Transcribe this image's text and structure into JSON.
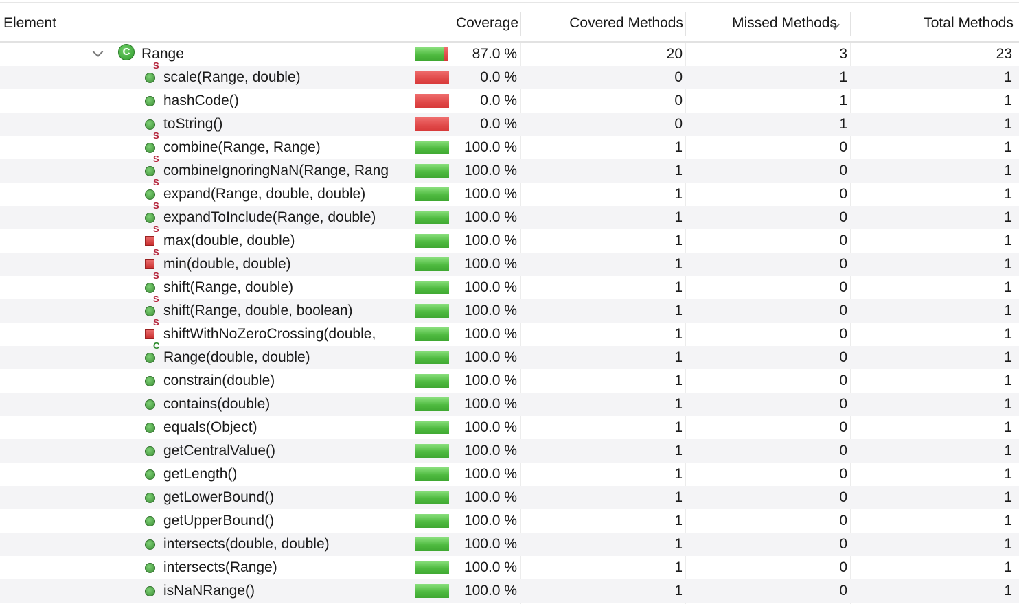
{
  "headers": {
    "element": "Element",
    "coverage": "Coverage",
    "covered": "Covered Methods",
    "missed": "Missed Methods",
    "total": "Total Methods",
    "sort_icon": "chevron-down-icon"
  },
  "top": {
    "name": "Range",
    "icon": "class-icon",
    "icon_letter": "C",
    "expanded": true,
    "pct": "87.0 %",
    "ratio": 0.87,
    "covered": "20",
    "missed": "3",
    "total": "23"
  },
  "rows": [
    {
      "name": "scale(Range, double)",
      "icon": "public",
      "mod": "S",
      "pct": "0.0 %",
      "ratio": 0,
      "covered": "0",
      "missed": "1",
      "total": "1"
    },
    {
      "name": "hashCode()",
      "icon": "public",
      "mod": "",
      "pct": "0.0 %",
      "ratio": 0,
      "covered": "0",
      "missed": "1",
      "total": "1"
    },
    {
      "name": "toString()",
      "icon": "public",
      "mod": "",
      "pct": "0.0 %",
      "ratio": 0,
      "covered": "0",
      "missed": "1",
      "total": "1"
    },
    {
      "name": "combine(Range, Range)",
      "icon": "public",
      "mod": "S",
      "pct": "100.0 %",
      "ratio": 1,
      "covered": "1",
      "missed": "0",
      "total": "1"
    },
    {
      "name": "combineIgnoringNaN(Range, Rang",
      "icon": "public",
      "mod": "S",
      "pct": "100.0 %",
      "ratio": 1,
      "covered": "1",
      "missed": "0",
      "total": "1"
    },
    {
      "name": "expand(Range, double, double)",
      "icon": "public",
      "mod": "S",
      "pct": "100.0 %",
      "ratio": 1,
      "covered": "1",
      "missed": "0",
      "total": "1"
    },
    {
      "name": "expandToInclude(Range, double)",
      "icon": "public",
      "mod": "S",
      "pct": "100.0 %",
      "ratio": 1,
      "covered": "1",
      "missed": "0",
      "total": "1"
    },
    {
      "name": "max(double, double)",
      "icon": "private",
      "mod": "S",
      "pct": "100.0 %",
      "ratio": 1,
      "covered": "1",
      "missed": "0",
      "total": "1"
    },
    {
      "name": "min(double, double)",
      "icon": "private",
      "mod": "S",
      "pct": "100.0 %",
      "ratio": 1,
      "covered": "1",
      "missed": "0",
      "total": "1"
    },
    {
      "name": "shift(Range, double)",
      "icon": "public",
      "mod": "S",
      "pct": "100.0 %",
      "ratio": 1,
      "covered": "1",
      "missed": "0",
      "total": "1"
    },
    {
      "name": "shift(Range, double, boolean)",
      "icon": "public",
      "mod": "S",
      "pct": "100.0 %",
      "ratio": 1,
      "covered": "1",
      "missed": "0",
      "total": "1"
    },
    {
      "name": "shiftWithNoZeroCrossing(double,",
      "icon": "private",
      "mod": "S",
      "pct": "100.0 %",
      "ratio": 1,
      "covered": "1",
      "missed": "0",
      "total": "1"
    },
    {
      "name": "Range(double, double)",
      "icon": "public",
      "mod": "C",
      "pct": "100.0 %",
      "ratio": 1,
      "covered": "1",
      "missed": "0",
      "total": "1"
    },
    {
      "name": "constrain(double)",
      "icon": "public",
      "mod": "",
      "pct": "100.0 %",
      "ratio": 1,
      "covered": "1",
      "missed": "0",
      "total": "1"
    },
    {
      "name": "contains(double)",
      "icon": "public",
      "mod": "",
      "pct": "100.0 %",
      "ratio": 1,
      "covered": "1",
      "missed": "0",
      "total": "1"
    },
    {
      "name": "equals(Object)",
      "icon": "public",
      "mod": "",
      "pct": "100.0 %",
      "ratio": 1,
      "covered": "1",
      "missed": "0",
      "total": "1"
    },
    {
      "name": "getCentralValue()",
      "icon": "public",
      "mod": "",
      "pct": "100.0 %",
      "ratio": 1,
      "covered": "1",
      "missed": "0",
      "total": "1"
    },
    {
      "name": "getLength()",
      "icon": "public",
      "mod": "",
      "pct": "100.0 %",
      "ratio": 1,
      "covered": "1",
      "missed": "0",
      "total": "1"
    },
    {
      "name": "getLowerBound()",
      "icon": "public",
      "mod": "",
      "pct": "100.0 %",
      "ratio": 1,
      "covered": "1",
      "missed": "0",
      "total": "1"
    },
    {
      "name": "getUpperBound()",
      "icon": "public",
      "mod": "",
      "pct": "100.0 %",
      "ratio": 1,
      "covered": "1",
      "missed": "0",
      "total": "1"
    },
    {
      "name": "intersects(double, double)",
      "icon": "public",
      "mod": "",
      "pct": "100.0 %",
      "ratio": 1,
      "covered": "1",
      "missed": "0",
      "total": "1"
    },
    {
      "name": "intersects(Range)",
      "icon": "public",
      "mod": "",
      "pct": "100.0 %",
      "ratio": 1,
      "covered": "1",
      "missed": "0",
      "total": "1"
    },
    {
      "name": "isNaNRange()",
      "icon": "public",
      "mod": "",
      "pct": "100.0 %",
      "ratio": 1,
      "covered": "1",
      "missed": "0",
      "total": "1"
    }
  ]
}
